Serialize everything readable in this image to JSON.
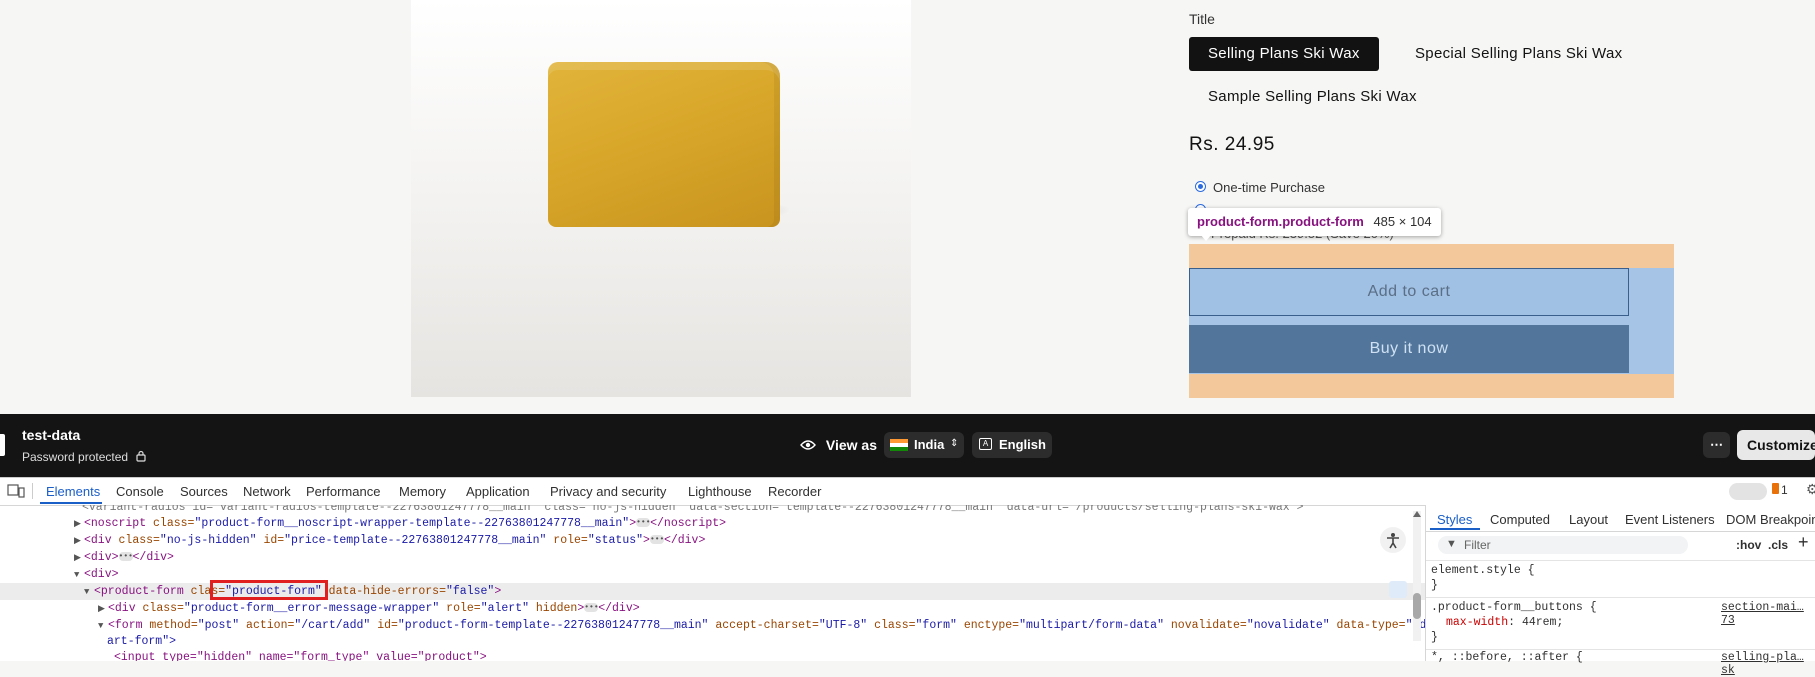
{
  "product": {
    "title_label": "Title",
    "variants": [
      "Selling Plans Ski Wax",
      "Special Selling Plans Ski Wax",
      "Sample Selling Plans Ski Wax"
    ],
    "price": "Rs. 24.95",
    "purchase_option": "One-time Purchase",
    "prepaid_partial": "Prepaid Rs. 239.52 (Save 20%)",
    "add_to_cart": "Add to cart",
    "buy_now": "Buy it now"
  },
  "inspector_tooltip": {
    "selector": "product-form.product-form",
    "size": "485 × 104"
  },
  "preview_bar": {
    "store_name": "test-data",
    "password_status": "Password protected",
    "view_as": "View as",
    "country": "India",
    "language": "English",
    "more": "⋯",
    "customize": "Customize"
  },
  "devtools": {
    "tabs": [
      "Elements",
      "Console",
      "Sources",
      "Network",
      "Performance",
      "Memory",
      "Application",
      "Privacy and security",
      "Lighthouse",
      "Recorder"
    ],
    "issues_count": "1",
    "code_lines": {
      "l0": "<variant-radios id=\"variant-radios-template--22763801247778__main\" class=\"no-js-hidden\" data-section=\"template--22763801247778__main\" data-url=\"/products/selling-plans-ski-wax\">",
      "l1_tag": "<noscript",
      "l1_attr": " class=",
      "l1_val": "\"product-form__noscript-wrapper-template--22763801247778__main\"",
      "l1_end": "></noscript>",
      "l2_tag": "<div",
      "l2_attr1": " class=",
      "l2_val1": "\"no-js-hidden\"",
      "l2_attr2": " id=",
      "l2_val2": "\"price-template--22763801247778__main\"",
      "l2_attr3": " role=",
      "l2_val3": "\"status\"",
      "l2_end": "></div>",
      "l3": "<div>",
      "l3_end": "</div>",
      "l4": "<div>",
      "l5_tag": "<product-form",
      "l5_attr_a": " cla",
      "l5_attr_b": "s=",
      "l5_val": "\"product-form\"",
      "l5_attr2": " data-hide-errors=",
      "l5_val2": "\"false\"",
      "l5_end": ">",
      "l6_tag": "<div",
      "l6_attr1": " class=",
      "l6_val1": "\"product-form__error-message-wrapper\"",
      "l6_attr2": " role=",
      "l6_val2": "\"alert\"",
      "l6_attr3": " hidden",
      "l6_end": "></div>",
      "l7_tag": "<form",
      "l7_attr1": " method=",
      "l7_val1": "\"post\"",
      "l7_attr2": " action=",
      "l7_val2": "\"/cart/add\"",
      "l7_attr3": " id=",
      "l7_val3": "\"product-form-template--22763801247778__main\"",
      "l7_attr4": " accept-charset=",
      "l7_val4": "\"UTF-8\"",
      "l7_attr5": " class=",
      "l7_val5": "\"form\"",
      "l7_attr6": " enctype=",
      "l7_val6": "\"multipart/form-data\"",
      "l7_attr7": " novalidate=",
      "l7_val7": "\"novalidate\"",
      "l7_attr8": " data-type=",
      "l7_val8": "\"add-to-c",
      "l8": "art-form\">",
      "l9": "<input type=\"hidden\" name=\"form_type\" value=\"product\">"
    },
    "styles_tabs": [
      "Styles",
      "Computed",
      "Layout",
      "Event Listeners",
      "DOM Breakpoints"
    ],
    "filter_placeholder": "Filter",
    "hov": ":hov",
    "cls": ".cls",
    "rule1_selector": "element.style {",
    "rule1_close": "}",
    "rule2_selector": ".product-form__buttons {",
    "rule2_source": "section-mai…73",
    "rule2_prop": "max-width",
    "rule2_value": "44rem;",
    "rule2_close": "}",
    "rule3_selector": "*, ::before, ::after {",
    "rule3_source": "selling-pla…sk"
  },
  "colors": {
    "margin_overlay": "#f3c99c",
    "padding_overlay": "#a6c5e6",
    "highlight_box": "#e02020"
  }
}
